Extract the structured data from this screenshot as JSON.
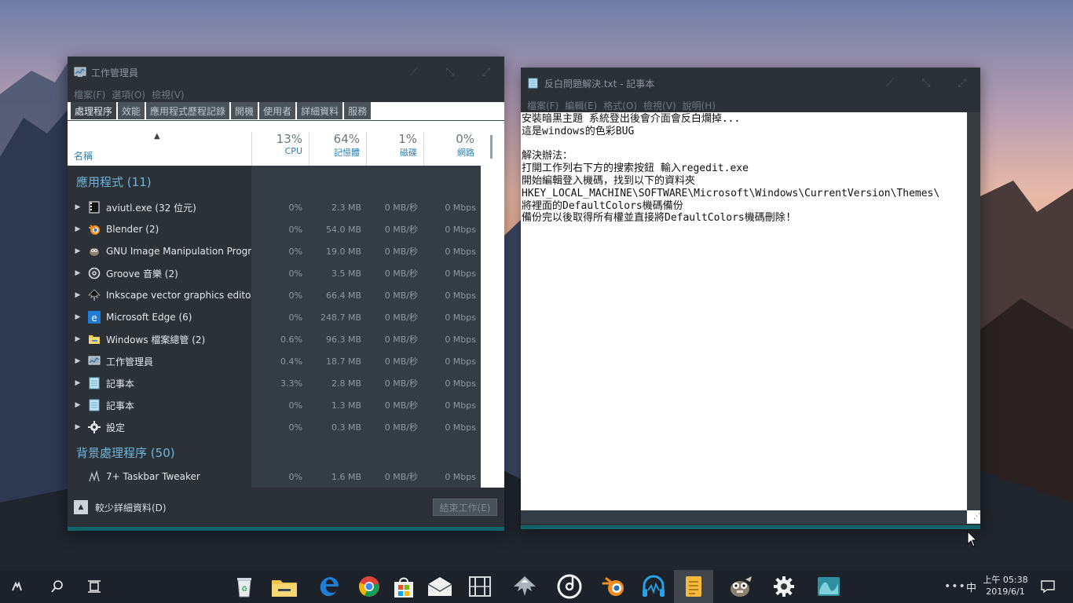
{
  "task_manager": {
    "title": "工作管理員",
    "menu": [
      "檔案(F)",
      "選項(O)",
      "檢視(V)"
    ],
    "tabs": [
      "處理程序",
      "效能",
      "應用程式歷程記錄",
      "開機",
      "使用者",
      "詳細資料",
      "服務"
    ],
    "columns": {
      "name": "名稱",
      "cpu": {
        "pct": "13%",
        "label": "CPU"
      },
      "mem": {
        "pct": "64%",
        "label": "記憶體"
      },
      "disk": {
        "pct": "1%",
        "label": "磁碟"
      },
      "net": {
        "pct": "0%",
        "label": "網路"
      }
    },
    "apps_section": {
      "label": "應用程式",
      "count": "(11)"
    },
    "apps": [
      {
        "name": "aviutl.exe (32 位元)",
        "icon": "film-icon",
        "cpu": "0%",
        "mem": "2.3 MB",
        "disk": "0 MB/秒",
        "net": "0 Mbps"
      },
      {
        "name": "Blender (2)",
        "icon": "blender-icon",
        "cpu": "0%",
        "mem": "54.0 MB",
        "disk": "0 MB/秒",
        "net": "0 Mbps"
      },
      {
        "name": "GNU Image Manipulation Progr...",
        "icon": "gimp-icon",
        "cpu": "0%",
        "mem": "19.0 MB",
        "disk": "0 MB/秒",
        "net": "0 Mbps"
      },
      {
        "name": "Groove 音樂 (2)",
        "icon": "groove-icon",
        "cpu": "0%",
        "mem": "3.5 MB",
        "disk": "0 MB/秒",
        "net": "0 Mbps"
      },
      {
        "name": "Inkscape vector graphics editor",
        "icon": "inkscape-icon",
        "cpu": "0%",
        "mem": "66.4 MB",
        "disk": "0 MB/秒",
        "net": "0 Mbps"
      },
      {
        "name": "Microsoft Edge (6)",
        "icon": "edge-icon",
        "cpu": "0%",
        "mem": "248.7 MB",
        "disk": "0 MB/秒",
        "net": "0 Mbps"
      },
      {
        "name": "Windows 檔案總管 (2)",
        "icon": "folder-icon",
        "cpu": "0.6%",
        "mem": "96.3 MB",
        "disk": "0 MB/秒",
        "net": "0 Mbps"
      },
      {
        "name": "工作管理員",
        "icon": "task-manager-icon",
        "cpu": "0.4%",
        "mem": "18.7 MB",
        "disk": "0 MB/秒",
        "net": "0 Mbps"
      },
      {
        "name": "記事本",
        "icon": "notepad-icon",
        "cpu": "3.3%",
        "mem": "2.8 MB",
        "disk": "0 MB/秒",
        "net": "0 Mbps"
      },
      {
        "name": "記事本",
        "icon": "notepad-icon",
        "cpu": "0%",
        "mem": "1.3 MB",
        "disk": "0 MB/秒",
        "net": "0 Mbps"
      },
      {
        "name": "設定",
        "icon": "gear-icon",
        "cpu": "0%",
        "mem": "0.3 MB",
        "disk": "0 MB/秒",
        "net": "0 Mbps"
      }
    ],
    "bg_section": {
      "label": "背景處理程序",
      "count": "(50)"
    },
    "bg": [
      {
        "name": "7+ Taskbar Tweaker",
        "icon": "tweaker-icon",
        "cpu": "0%",
        "mem": "1.6 MB",
        "disk": "0 MB/秒",
        "net": "0 Mbps"
      }
    ],
    "footer": {
      "fewer": "較少詳細資料(D)",
      "end_task": "結束工作(E)"
    }
  },
  "notepad": {
    "title": "反白問題解決.txt - 記事本",
    "menu": [
      "檔案(F)",
      "編輯(E)",
      "格式(O)",
      "檢視(V)",
      "說明(H)"
    ],
    "content": "安裝暗黑主題 系統登出後會介面會反白爛掉...\n這是windows的色彩BUG\n\n解決辦法：\n打開工作列右下方的搜索按鈕 輸入regedit.exe\n開始編輯登入機碼，找到以下的資料夾\nHKEY_LOCAL_MACHINE\\SOFTWARE\\Microsoft\\Windows\\CurrentVersion\\Themes\\\n將裡面的DefaultColors機碼備份\n備份完以後取得所有權並直接將DefaultColors機碼刪除!"
  },
  "taskbar": {
    "pinned": [
      "recycle-bin-icon",
      "file-explorer-icon",
      "edge-icon",
      "chrome-icon",
      "store-icon",
      "mail-icon",
      "film-icon",
      "inkscape-icon",
      "groove-icon",
      "blender-icon",
      "audio-icon",
      "notepad-icon",
      "gimp-icon",
      "settings-icon",
      "wave-icon"
    ],
    "ime": "中",
    "time": "上午 05:38",
    "date": "2019/6/1"
  }
}
